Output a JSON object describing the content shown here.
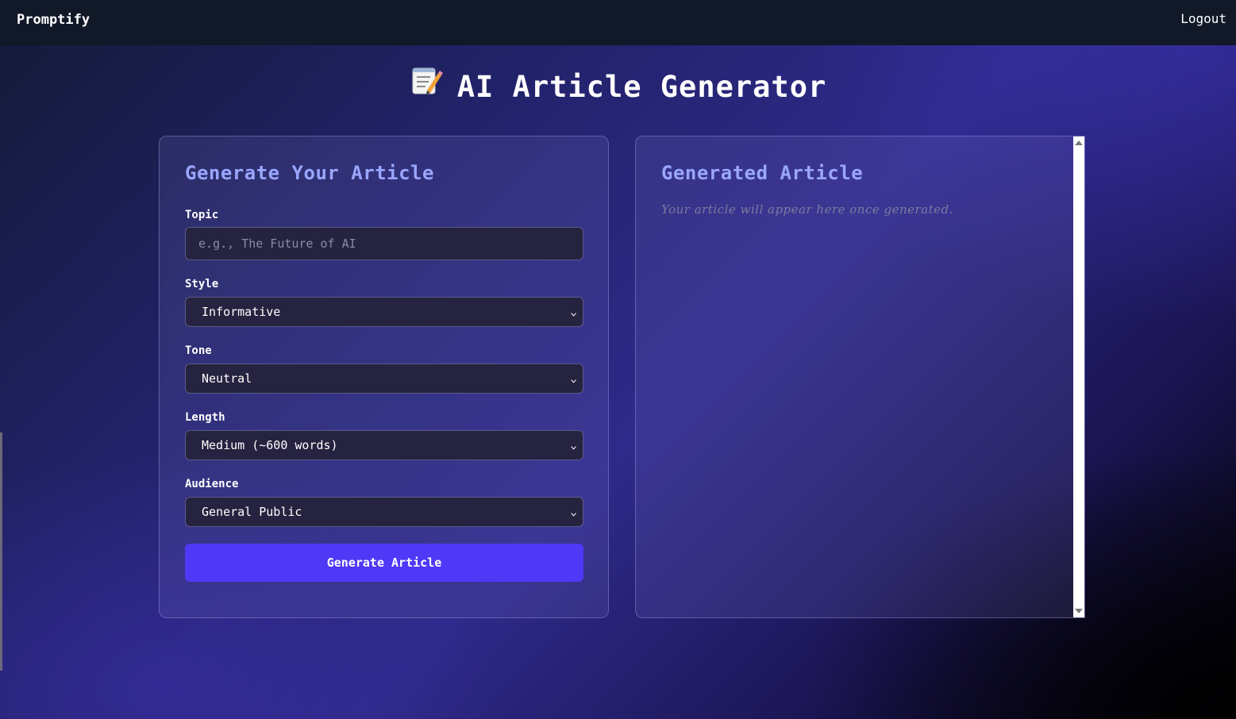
{
  "navbar": {
    "brand": "Promptify",
    "logout_label": "Logout"
  },
  "page": {
    "title_icon": "📝",
    "title": "AI Article Generator"
  },
  "form": {
    "heading": "Generate Your Article",
    "topic": {
      "label": "Topic",
      "value": "",
      "placeholder": "e.g., The Future of AI"
    },
    "style": {
      "label": "Style",
      "selected": "Informative"
    },
    "tone": {
      "label": "Tone",
      "selected": "Neutral"
    },
    "length": {
      "label": "Length",
      "selected": "Medium (~600 words)"
    },
    "audience": {
      "label": "Audience",
      "selected": "General Public"
    },
    "submit_label": "Generate Article"
  },
  "output": {
    "heading": "Generated Article",
    "placeholder": "Your article will appear here once generated."
  },
  "icons": {
    "title": "memo-icon",
    "select_chevron": "chevron-down-icon",
    "scroll_up": "scroll-up-arrow-icon",
    "scroll_down": "scroll-down-arrow-icon"
  },
  "colors": {
    "navbar_bg": "#111827",
    "accent_heading": "#9aa6ff",
    "button_bg": "#4f39f6"
  }
}
